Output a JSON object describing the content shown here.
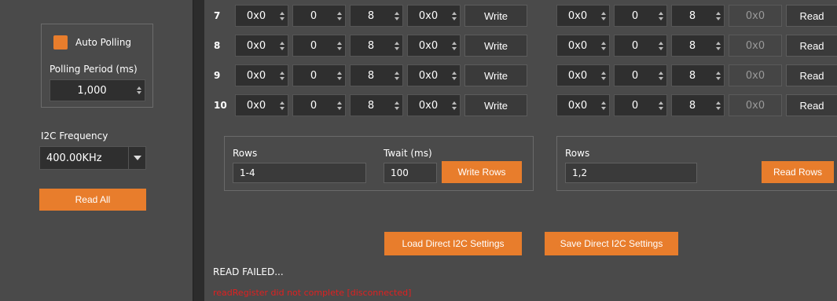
{
  "left": {
    "auto_polling_label": "Auto Polling",
    "polling_period_label": "Polling Period (ms)",
    "polling_period_value": "1,000",
    "i2c_frequency_label": "I2C Frequency",
    "i2c_frequency_value": "400.00KHz",
    "read_all_label": "Read All"
  },
  "rows": [
    {
      "num": "7",
      "w_addr": "0x0",
      "w_reg": "0",
      "w_bits": "8",
      "w_val": "0x0",
      "write_label": "Write",
      "r_addr": "0x0",
      "r_reg": "0",
      "r_bits": "8",
      "r_val": "0x0",
      "read_label": "Read"
    },
    {
      "num": "8",
      "w_addr": "0x0",
      "w_reg": "0",
      "w_bits": "8",
      "w_val": "0x0",
      "write_label": "Write",
      "r_addr": "0x0",
      "r_reg": "0",
      "r_bits": "8",
      "r_val": "0x0",
      "read_label": "Read"
    },
    {
      "num": "9",
      "w_addr": "0x0",
      "w_reg": "0",
      "w_bits": "8",
      "w_val": "0x0",
      "write_label": "Write",
      "r_addr": "0x0",
      "r_reg": "0",
      "r_bits": "8",
      "r_val": "0x0",
      "read_label": "Read"
    },
    {
      "num": "10",
      "w_addr": "0x0",
      "w_reg": "0",
      "w_bits": "8",
      "w_val": "0x0",
      "write_label": "Write",
      "r_addr": "0x0",
      "r_reg": "0",
      "r_bits": "8",
      "r_val": "0x0",
      "read_label": "Read"
    }
  ],
  "write_rows": {
    "rows_label": "Rows",
    "rows_value": "1-4",
    "twait_label": "Twait (ms)",
    "twait_value": "100",
    "button_label": "Write Rows"
  },
  "read_rows": {
    "rows_label": "Rows",
    "rows_value": "1,2",
    "button_label": "Read Rows"
  },
  "load_settings_label": "Load Direct I2C Settings",
  "save_settings_label": "Save Direct I2C Settings",
  "status": {
    "line1": "READ FAILED...",
    "line2": "readRegister did not complete [disconnected]",
    "error_color": "#e02020"
  },
  "colors": {
    "accent": "#e87d2c",
    "background": "#4a4a4a"
  }
}
